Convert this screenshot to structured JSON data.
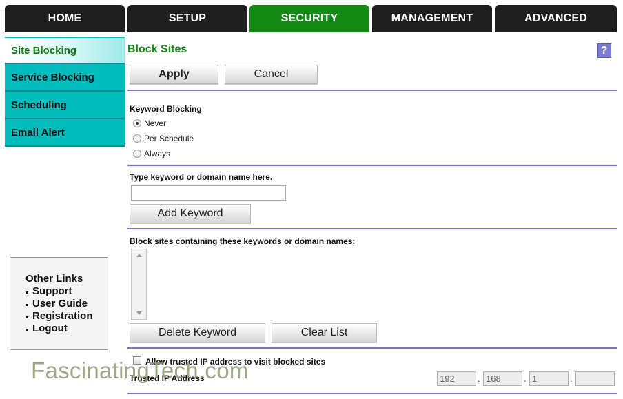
{
  "topnav": {
    "tabs": [
      {
        "label": "HOME",
        "active": false
      },
      {
        "label": "SETUP",
        "active": false
      },
      {
        "label": "SECURITY",
        "active": true
      },
      {
        "label": "MANAGEMENT",
        "active": false
      },
      {
        "label": "ADVANCED",
        "active": false
      }
    ]
  },
  "sidebar": {
    "items": [
      {
        "label": "Site Blocking",
        "active": true
      },
      {
        "label": "Service Blocking",
        "active": false
      },
      {
        "label": "Scheduling",
        "active": false
      },
      {
        "label": "Email Alert",
        "active": false
      }
    ]
  },
  "other_links": {
    "title": "Other Links",
    "links": [
      "Support",
      "User Guide",
      "Registration",
      "Logout"
    ]
  },
  "main": {
    "title": "Block Sites",
    "help_label": "?",
    "apply_label": "Apply",
    "cancel_label": "Cancel",
    "keyword_blocking": {
      "label": "Keyword Blocking",
      "options": [
        {
          "label": "Never",
          "checked": true
        },
        {
          "label": "Per Schedule",
          "checked": false
        },
        {
          "label": "Always",
          "checked": false
        }
      ]
    },
    "keyword_input": {
      "label": "Type keyword or domain name here.",
      "value": "",
      "add_label": "Add Keyword"
    },
    "keyword_list": {
      "label": "Block sites containing these keywords or domain names:",
      "items": [],
      "delete_label": "Delete Keyword",
      "clear_label": "Clear List"
    },
    "trusted": {
      "checkbox_label": "Allow trusted IP address to visit blocked sites",
      "checked": false,
      "ip_label": "Trusted IP Address",
      "ip_octets": [
        "192",
        "168",
        "1",
        ""
      ],
      "separator": "."
    }
  },
  "watermark": "FascinatingTech.com",
  "colors": {
    "tab_bg": "#1e1e1e",
    "tab_active": "#138a13",
    "sidebar_bg": "#00bcbc",
    "title_green": "#138a13",
    "divider": "#7b6fc9",
    "help_bg": "#7b7bd6"
  }
}
